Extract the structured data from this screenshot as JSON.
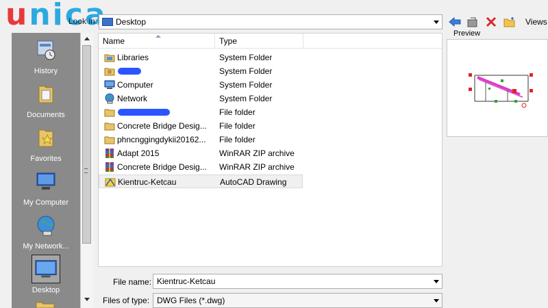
{
  "logo": {
    "text": "unica"
  },
  "look_in": {
    "label": "Look in:",
    "value": "Desktop"
  },
  "toolbar": {
    "views_label": "Views"
  },
  "places": [
    {
      "label": "History"
    },
    {
      "label": "Documents"
    },
    {
      "label": "Favorites"
    },
    {
      "label": "My Computer"
    },
    {
      "label": "My Network..."
    },
    {
      "label": "Desktop"
    }
  ],
  "filelist": {
    "columns": [
      "Name",
      "Type"
    ],
    "rows": [
      {
        "name": "Libraries",
        "type": "System Folder",
        "icon": "libraries-icon"
      },
      {
        "name": "",
        "type": "System Folder",
        "icon": "user-folder-icon",
        "redacted": true
      },
      {
        "name": "Computer",
        "type": "System Folder",
        "icon": "computer-icon"
      },
      {
        "name": "Network",
        "type": "System Folder",
        "icon": "network-icon"
      },
      {
        "name": "",
        "type": "File folder",
        "icon": "folder-icon",
        "redacted": true
      },
      {
        "name": "Concrete Bridge Desig...",
        "type": "File folder",
        "icon": "folder-icon"
      },
      {
        "name": "phncnggingdykii20162...",
        "type": "File folder",
        "icon": "folder-icon"
      },
      {
        "name": "Adapt 2015",
        "type": "WinRAR ZIP archive",
        "icon": "winrar-icon"
      },
      {
        "name": "Concrete Bridge Desig...",
        "type": "WinRAR ZIP archive",
        "icon": "winrar-icon"
      },
      {
        "name": "Kientruc-Ketcau",
        "type": "AutoCAD Drawing",
        "icon": "autocad-drawing-icon",
        "selected": true
      }
    ]
  },
  "preview": {
    "label": "Preview"
  },
  "file_name": {
    "label": "File name:",
    "value": "Kientruc-Ketcau"
  },
  "files_of_type": {
    "label": "Files of type:",
    "value": "DWG Files  (*.dwg)"
  },
  "colors": {
    "places_bg": "#8a8a8a",
    "logo_blue": "#2da9e1",
    "logo_red": "#e8383d"
  }
}
